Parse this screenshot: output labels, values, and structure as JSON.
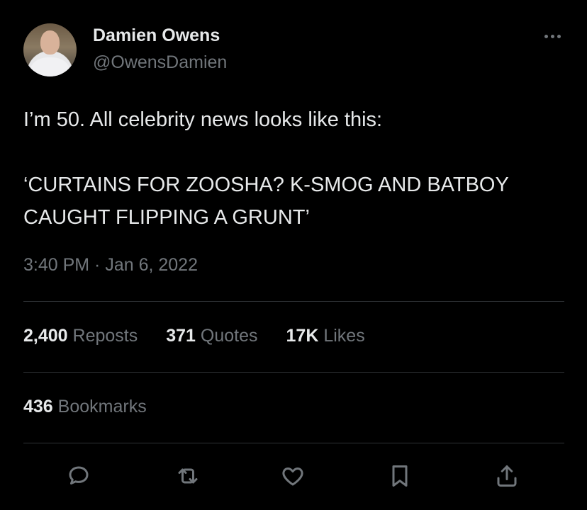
{
  "author": {
    "display_name": "Damien Owens",
    "handle": "@OwensDamien"
  },
  "tweet": {
    "line1": "I’m 50. All celebrity news looks like this:",
    "line2": "‘CURTAINS FOR ZOOSHA? K-SMOG AND BATBOY",
    "line3": "CAUGHT FLIPPING A GRUNT’",
    "timestamp": "3:40 PM · Jan 6, 2022"
  },
  "stats": {
    "reposts_count": "2,400",
    "reposts_label": "Reposts",
    "quotes_count": "371",
    "quotes_label": "Quotes",
    "likes_count": "17K",
    "likes_label": "Likes",
    "bookmarks_count": "436",
    "bookmarks_label": "Bookmarks"
  },
  "actions": [
    "reply-icon",
    "repost-icon",
    "like-icon",
    "bookmark-icon",
    "share-icon"
  ],
  "colors": {
    "background": "#000000",
    "text_primary": "#e7e9ea",
    "text_secondary": "#71767b",
    "divider": "#2f3336"
  }
}
